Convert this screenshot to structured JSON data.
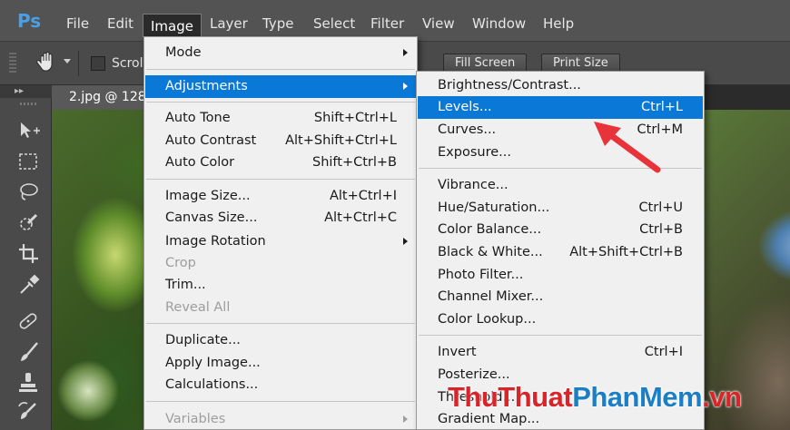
{
  "app": {
    "logo": "Ps",
    "menu": [
      "File",
      "Edit",
      "Image",
      "Layer",
      "Type",
      "Select",
      "Filter",
      "View",
      "Window",
      "Help"
    ],
    "active_menu": "Image"
  },
  "options_bar": {
    "tool_icon": "hand-icon",
    "scroll_all_label": "Scroll",
    "fill_screen_label": "Fill Screen",
    "print_size_label": "Print Size"
  },
  "document": {
    "tab_title": "2.jpg @ 128"
  },
  "tools": [
    "move-tool-icon",
    "marquee-tool-icon",
    "lasso-tool-icon",
    "quick-selection-tool-icon",
    "crop-tool-icon",
    "eyedropper-tool-icon",
    "healing-brush-tool-icon",
    "brush-tool-icon",
    "clone-stamp-tool-icon",
    "history-brush-tool-icon"
  ],
  "image_menu": [
    {
      "label": "Mode",
      "shortcut": "",
      "submenu": true
    },
    {
      "label": "Adjustments",
      "shortcut": "",
      "submenu": true,
      "highlighted": true
    },
    {
      "label": "Auto Tone",
      "shortcut": "Shift+Ctrl+L"
    },
    {
      "label": "Auto Contrast",
      "shortcut": "Alt+Shift+Ctrl+L"
    },
    {
      "label": "Auto Color",
      "shortcut": "Shift+Ctrl+B"
    },
    {
      "label": "Image Size...",
      "shortcut": "Alt+Ctrl+I"
    },
    {
      "label": "Canvas Size...",
      "shortcut": "Alt+Ctrl+C"
    },
    {
      "label": "Image Rotation",
      "shortcut": "",
      "submenu": true
    },
    {
      "label": "Crop",
      "shortcut": "",
      "disabled": true
    },
    {
      "label": "Trim...",
      "shortcut": ""
    },
    {
      "label": "Reveal All",
      "shortcut": "",
      "disabled": true
    },
    {
      "label": "Duplicate...",
      "shortcut": ""
    },
    {
      "label": "Apply Image...",
      "shortcut": ""
    },
    {
      "label": "Calculations...",
      "shortcut": ""
    },
    {
      "label": "Variables",
      "shortcut": "",
      "submenu": true,
      "disabled": true
    }
  ],
  "adjustments_menu": [
    {
      "label": "Brightness/Contrast...",
      "shortcut": ""
    },
    {
      "label": "Levels...",
      "shortcut": "Ctrl+L",
      "highlighted": true
    },
    {
      "label": "Curves...",
      "shortcut": "Ctrl+M"
    },
    {
      "label": "Exposure...",
      "shortcut": ""
    },
    {
      "label": "Vibrance...",
      "shortcut": ""
    },
    {
      "label": "Hue/Saturation...",
      "shortcut": "Ctrl+U"
    },
    {
      "label": "Color Balance...",
      "shortcut": "Ctrl+B"
    },
    {
      "label": "Black & White...",
      "shortcut": "Alt+Shift+Ctrl+B"
    },
    {
      "label": "Photo Filter...",
      "shortcut": ""
    },
    {
      "label": "Channel Mixer...",
      "shortcut": ""
    },
    {
      "label": "Color Lookup...",
      "shortcut": ""
    },
    {
      "label": "Invert",
      "shortcut": "Ctrl+I"
    },
    {
      "label": "Posterize...",
      "shortcut": ""
    },
    {
      "label": "Threshold...",
      "shortcut": ""
    },
    {
      "label": "Gradient Map...",
      "shortcut": ""
    }
  ],
  "watermark": {
    "part1": "ThuThuat",
    "part2": "PhanMem",
    "part3": ".vn"
  },
  "colors": {
    "highlight": "#0a78d7",
    "arrow": "#e8333a",
    "watermark_red": "#d9242a",
    "watermark_blue": "#1c7fc6"
  }
}
